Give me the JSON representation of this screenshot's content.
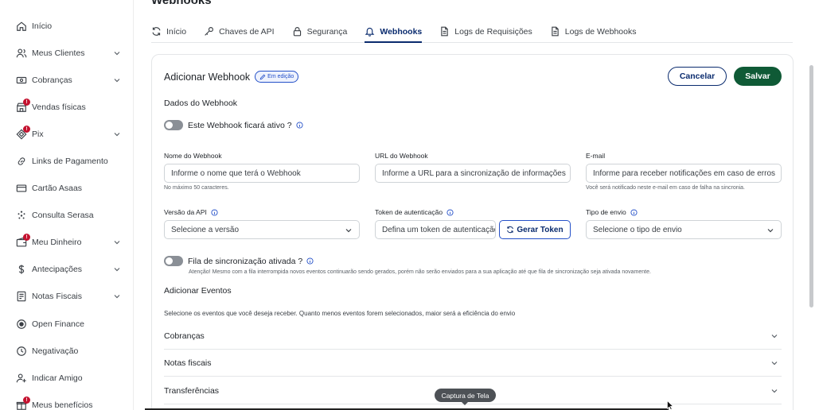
{
  "page": {
    "title": "Webhooks"
  },
  "sidebar": {
    "items": [
      {
        "label": "Início",
        "icon": "home-icon"
      },
      {
        "label": "Meus Clientes",
        "icon": "users-icon",
        "expandable": true
      },
      {
        "label": "Cobranças",
        "icon": "money-icon",
        "expandable": true
      },
      {
        "label": "Vendas físicas",
        "icon": "store-icon",
        "badge": "!"
      },
      {
        "label": "Pix",
        "icon": "pix-icon",
        "badge": "!",
        "expandable": true
      },
      {
        "label": "Links de Pagamento",
        "icon": "link-icon"
      },
      {
        "label": "Cartão Asaas",
        "icon": "card-icon"
      },
      {
        "label": "Consulta Serasa",
        "icon": "sparkle-icon"
      },
      {
        "label": "Meu Dinheiro",
        "icon": "wallet-icon",
        "badge": "!",
        "expandable": true
      },
      {
        "label": "Antecipações",
        "icon": "dollar-icon",
        "expandable": true
      },
      {
        "label": "Notas Fiscais",
        "icon": "invoice-icon",
        "expandable": true
      },
      {
        "label": "Open Finance",
        "icon": "openfinance-icon"
      },
      {
        "label": "Negativação",
        "icon": "negativation-icon"
      },
      {
        "label": "Indicar Amigo",
        "icon": "add-user-icon"
      },
      {
        "label": "Meus benefícios",
        "icon": "gift-icon",
        "badge": "!"
      }
    ]
  },
  "tabs": [
    {
      "label": "Início",
      "icon": "refresh-icon",
      "active": false
    },
    {
      "label": "Chaves de API",
      "icon": "key-icon",
      "active": false
    },
    {
      "label": "Segurança",
      "icon": "lock-icon",
      "active": false
    },
    {
      "label": "Webhooks",
      "icon": "bell-icon",
      "active": true
    },
    {
      "label": "Logs de Requisições",
      "icon": "document-icon",
      "active": false
    },
    {
      "label": "Logs de Webhooks",
      "icon": "document-icon",
      "active": false
    }
  ],
  "card": {
    "title": "Adicionar Webhook",
    "badge": "Em edição",
    "cancel_label": "Cancelar",
    "save_label": "Salvar"
  },
  "webhook_data": {
    "section_title": "Dados do Webhook",
    "active_toggle_label": "Este Webhook ficará ativo ?",
    "name": {
      "label": "Nome do Webhook",
      "placeholder": "Informe o nome que terá o Webhook",
      "hint": "No máximo 50 caracteres."
    },
    "url": {
      "label": "URL do Webhook",
      "placeholder": "Informe a URL para a sincronização de informações"
    },
    "email": {
      "label": "E-mail",
      "placeholder": "Informe para receber notificações em caso de erros",
      "hint": "Você será notificado neste e-mail em caso de falha na sincronia."
    },
    "api_version": {
      "label": "Versão da API",
      "placeholder": "Selecione a versão"
    },
    "token": {
      "label": "Token de autenticação",
      "placeholder": "Defina um token de autenticação",
      "button_label": "Gerar Token"
    },
    "send_type": {
      "label": "Tipo de envio",
      "placeholder": "Selecione o tipo de envio"
    },
    "queue_toggle_label": "Fila de sincronização ativada ?",
    "queue_warning": "Atenção! Mesmo com a fila interrompida novos eventos continuarão sendo gerados, porém não serão enviados para a sua aplicação até que fila de sincronização seja ativada novamente."
  },
  "events": {
    "section_title": "Adicionar Eventos",
    "description": "Selecione os eventos que você deseja receber. Quanto menos eventos forem selecionados, maior será a eficiência do envio",
    "groups": [
      {
        "label": "Cobranças"
      },
      {
        "label": "Notas fiscais"
      },
      {
        "label": "Transferências"
      }
    ]
  },
  "tooltip": {
    "text": "Captura de Tela"
  },
  "colors": {
    "primary": "#0a2b6e",
    "accent": "#2450c8",
    "save": "#0f5a36",
    "badge": "#c4122f"
  }
}
